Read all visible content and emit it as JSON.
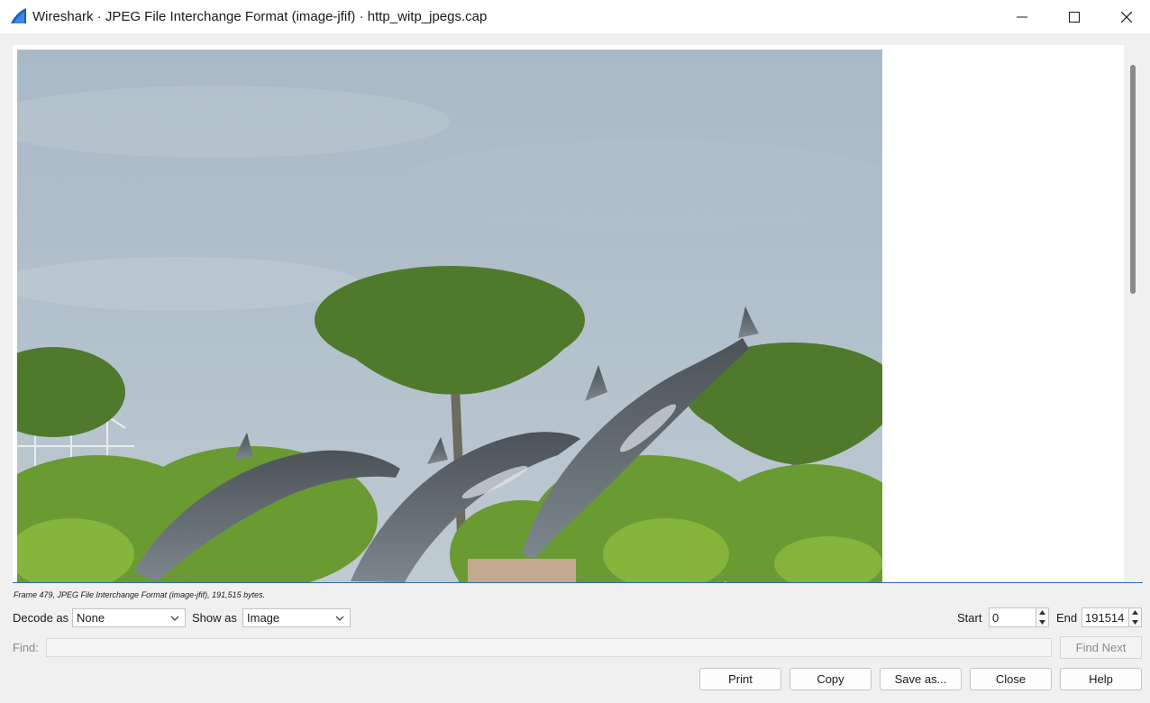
{
  "window": {
    "title": "Wireshark · JPEG File Interchange Format (image-jfif) · http_witp_jpegs.cap",
    "app_icon": "wireshark-fin-icon"
  },
  "colors": {
    "accent": "#2b6cb0",
    "icon_blue": "#1b5fc1"
  },
  "viewer": {
    "content": "jpeg-image",
    "scroll_thumb_fraction": 0.43
  },
  "status_text": "Frame 479, JPEG File Interchange Format (image-jfif), 191,515 bytes.",
  "controls": {
    "decode_label": "Decode as",
    "decode_value": "None",
    "show_label": "Show as",
    "show_value": "Image",
    "start_label": "Start",
    "start_value": "0",
    "end_label": "End",
    "end_value": "191514"
  },
  "find": {
    "label": "Find:",
    "value": "",
    "next_label": "Find Next"
  },
  "buttons": {
    "print": "Print",
    "copy": "Copy",
    "save_as": "Save as...",
    "close": "Close",
    "help": "Help"
  }
}
